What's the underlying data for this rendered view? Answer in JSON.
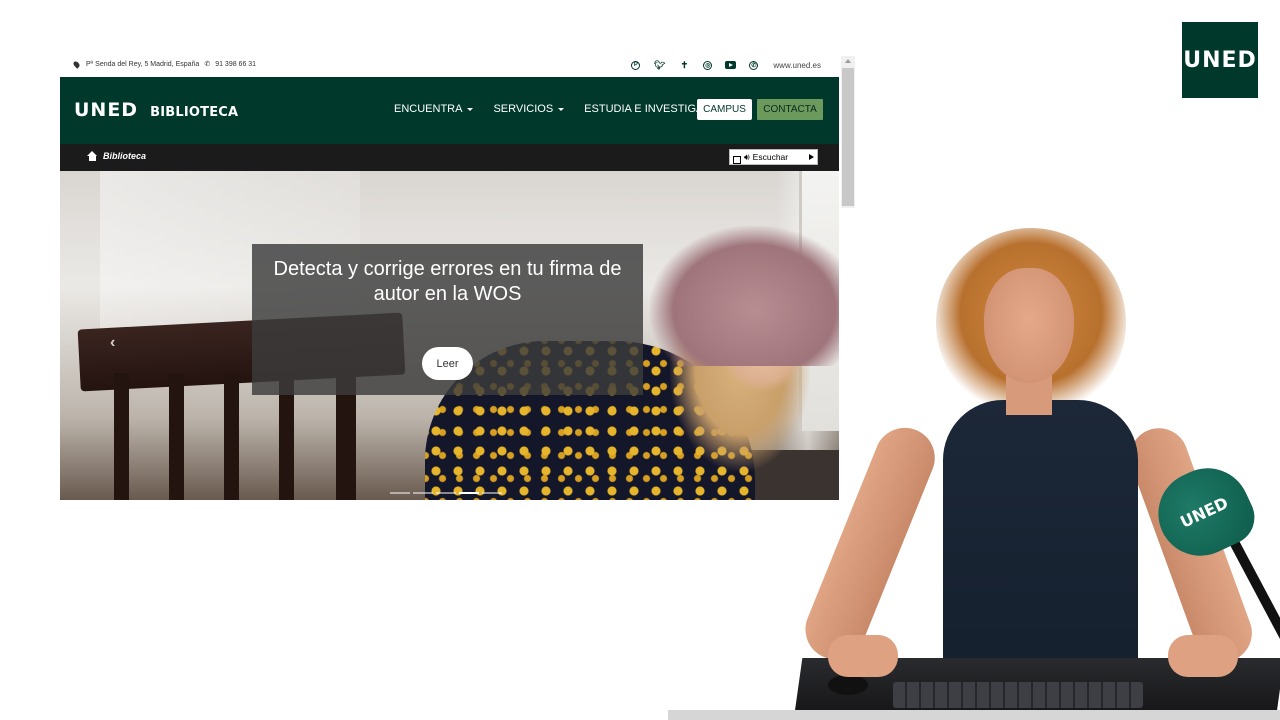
{
  "corner_logo": {
    "text": "UNED"
  },
  "topbar": {
    "address": "Pº Senda del Rey, 5 Madrid, España",
    "phone": "91 398 66 31",
    "social_icons": [
      "pinterest-icon",
      "twitter-icon",
      "cross-icon",
      "instagram-icon",
      "youtube-icon",
      "whatsapp-icon"
    ],
    "site_url": "www.uned.es"
  },
  "navbar": {
    "logo": "UNED",
    "section": "BIBLIOTECA",
    "menu": [
      {
        "label": "ENCUENTRA",
        "dropdown": true
      },
      {
        "label": "SERVICIOS",
        "dropdown": true
      },
      {
        "label": "ESTUDIA E INVESTIGA",
        "dropdown": true
      }
    ],
    "campus_label": "CAMPUS",
    "contact_label": "CONTACTA",
    "colors": {
      "primary": "#00382c",
      "contact_bg": "#6b9a5c"
    }
  },
  "breadcrumb": {
    "home_icon": "home-icon",
    "label": "Biblioteca",
    "listen_label": "Escuchar"
  },
  "hero": {
    "title": "Detecta y corrige errores en tu firma de autor en la WOS",
    "button_label": "Leer",
    "prev_glyph": "‹",
    "indicators": 5,
    "active_indicator": 4
  },
  "presenter": {
    "mic_logo": "UNED"
  }
}
